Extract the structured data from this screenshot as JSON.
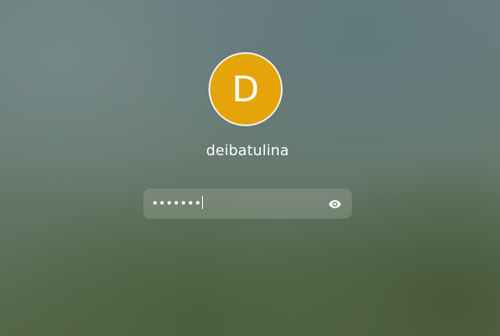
{
  "user": {
    "avatar_initial": "D",
    "avatar_color": "#e5a50a",
    "username": "deibatulina"
  },
  "password": {
    "masked_value": "•••••••",
    "reveal_icon": "eye-icon"
  }
}
